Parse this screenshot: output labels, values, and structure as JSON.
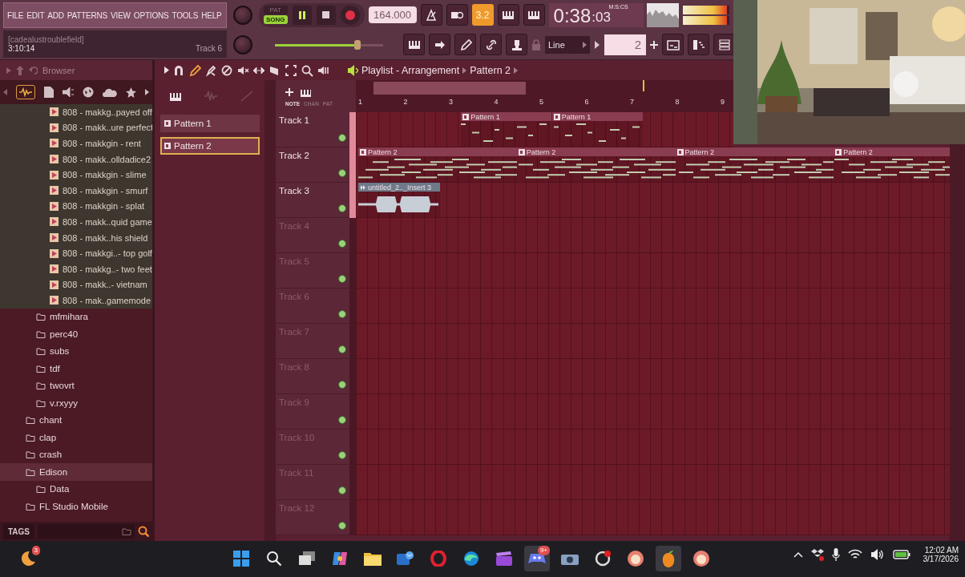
{
  "menu": [
    "FILE",
    "EDIT",
    "ADD",
    "PATTERNS",
    "VIEW",
    "OPTIONS",
    "TOOLS",
    "HELP"
  ],
  "hint": {
    "title": "[cadealustroublefield]",
    "time": "3:10:14",
    "track": "Track 6"
  },
  "transport": {
    "modes": [
      {
        "label": "PAT",
        "selected": false
      },
      {
        "label": "SONG",
        "selected": true
      }
    ],
    "playing": true,
    "tempo": "164.000",
    "snap": "3.2",
    "time": {
      "main": "0:38",
      "sub": ":03",
      "unit": "M:S:CS"
    },
    "meter": {
      "level": 0.96
    },
    "master_volume": {
      "level": 0.76
    },
    "snap_mode": "Line",
    "pattern_number": "2"
  },
  "browser": {
    "title": "Browser",
    "items": [
      {
        "children": [
          {
            "children": [
              {
                "kind": "file",
                "label": "808 - makkg..payed off",
                "selected": false
              },
              {
                "kind": "file",
                "label": "808 - makk..ure perfect",
                "selected": false
              },
              {
                "kind": "file",
                "label": "808 - makkgin - rent",
                "selected": false
              },
              {
                "kind": "file",
                "label": "808 - makk..olldadice2",
                "selected": false
              },
              {
                "kind": "file",
                "label": "808 - makkgin - slime",
                "selected": false
              },
              {
                "kind": "file",
                "label": "808 - makkgin - smurf",
                "selected": false
              },
              {
                "kind": "file",
                "label": "808 - makkgin - splat",
                "selected": false
              },
              {
                "kind": "file",
                "label": "808 - makk..quid game",
                "selected": false
              },
              {
                "kind": "file",
                "label": "808 - makk..his shield",
                "selected": false
              },
              {
                "kind": "file",
                "label": "808 - makkgi..- top golf",
                "selected": false
              },
              {
                "kind": "file",
                "label": "808 - makkg..- two feet",
                "selected": false
              },
              {
                "kind": "file",
                "label": "808 - makk..- vietnam",
                "selected": false
              },
              {
                "kind": "file",
                "label": "808 - mak..gamemode",
                "selected": false
              }
            ]
          },
          {
            "kind": "folder",
            "label": "mfmihara",
            "selected": false
          },
          {
            "kind": "folder",
            "label": "perc40",
            "selected": false
          },
          {
            "kind": "folder",
            "label": "subs",
            "selected": false
          },
          {
            "kind": "folder",
            "label": "tdf",
            "selected": false
          },
          {
            "kind": "folder",
            "label": "twovrt",
            "selected": false
          },
          {
            "kind": "folder",
            "label": "v.rxyyy",
            "selected": false
          }
        ]
      },
      {
        "kind": "folder",
        "label": "chant",
        "selected": false
      },
      {
        "kind": "folder",
        "label": "clap",
        "selected": false
      },
      {
        "kind": "folder",
        "label": "crash",
        "selected": false
      },
      {
        "kind": "folder",
        "label": "Edison",
        "selected": true,
        "children": [
          {
            "kind": "folder",
            "label": "Data",
            "selected": false
          }
        ]
      },
      {
        "kind": "folder",
        "label": "FL Studio Mobile",
        "selected": false
      }
    ],
    "tags": "TAGS"
  },
  "playlist": {
    "title": "Playlist - Arrangement",
    "pattern": "Pattern 2",
    "tools": [
      {
        "kind": "magnet",
        "selected": false
      },
      {
        "kind": "pencil",
        "selected": true
      },
      {
        "kind": "brush",
        "selected": false
      },
      {
        "kind": "delete",
        "selected": false
      },
      {
        "kind": "mute",
        "selected": false
      },
      {
        "kind": "slip",
        "selected": false
      },
      {
        "kind": "slice",
        "selected": false
      },
      {
        "kind": "select",
        "selected": false
      },
      {
        "kind": "zoom",
        "selected": false
      },
      {
        "kind": "playback",
        "selected": false
      }
    ],
    "filters": [
      {
        "label": "NOTE",
        "selected": true
      },
      {
        "label": "CHAN",
        "selected": false
      },
      {
        "label": "PAT",
        "selected": false
      }
    ],
    "patterns": [
      {
        "label": "Pattern 1",
        "selected": false
      },
      {
        "label": "Pattern 2",
        "selected": true
      }
    ],
    "ruler": [
      "1",
      "2",
      "3",
      "4",
      "5",
      "6",
      "7",
      "8",
      "9"
    ],
    "tracks": [
      {
        "name": "Track 1",
        "clips": [
          {
            "kind": "pattern",
            "label": "Pattern 1"
          },
          {
            "kind": "pattern",
            "label": "Pattern 1"
          }
        ]
      },
      {
        "name": "Track 2",
        "clips": [
          {
            "kind": "pattern",
            "label": "Pattern 2"
          },
          {
            "kind": "pattern",
            "label": "Pattern 2"
          },
          {
            "kind": "pattern",
            "label": "Pattern 2"
          },
          {
            "kind": "pattern",
            "label": "Pattern 2"
          }
        ]
      },
      {
        "name": "Track 3",
        "clips": [
          {
            "kind": "audio",
            "label": "untitled_2.._Insert 3"
          }
        ]
      },
      {
        "name": "Track 4"
      },
      {
        "name": "Track 5"
      },
      {
        "name": "Track 6"
      },
      {
        "name": "Track 7"
      },
      {
        "name": "Track 8"
      },
      {
        "name": "Track 9"
      },
      {
        "name": "Track 10"
      },
      {
        "name": "Track 11"
      },
      {
        "name": "Track 12"
      }
    ]
  },
  "taskbar": {
    "widget_badge": "3",
    "chat_badge": "9+",
    "time": "12:02 AM",
    "date": "3/17/2026"
  }
}
